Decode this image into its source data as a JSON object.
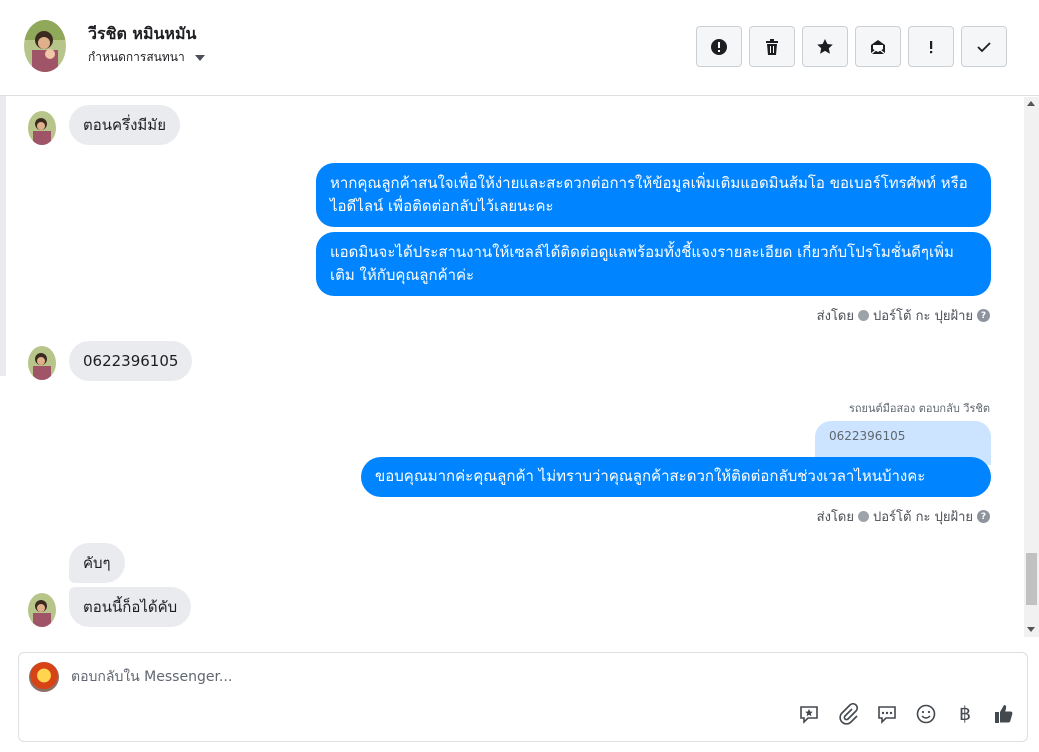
{
  "header": {
    "name": "วีรชิต หมินหมัน",
    "subtitle": "กำหนดการสนทนา"
  },
  "actions": [
    {
      "name": "spam-button",
      "icon": "exclamation-circle-icon"
    },
    {
      "name": "delete-button",
      "icon": "trash-icon"
    },
    {
      "name": "star-button",
      "icon": "star-icon"
    },
    {
      "name": "mark-unread-button",
      "icon": "envelope-open-icon"
    },
    {
      "name": "important-button",
      "icon": "exclamation-icon"
    },
    {
      "name": "done-button",
      "icon": "check-icon"
    }
  ],
  "messages": {
    "m1": "ตอนครึ่งมีมัย",
    "m2": "หากคุณลูกค้าสนใจเพื่อให้ง่ายและสะดวกต่อการให้ข้อมูลเพิ่มเติมแอดมินส้มโอ ขอเบอร์โทรศัพท์ หรือ ไอดีไลน์ เพื่อติดต่อกลับไว้เลยนะคะ",
    "m3": "แอดมินจะได้ประสานงานให้เซลล์ได้ติดต่อดูแลพร้อมทั้งชี้แจงรายละเอียด เกี่ยวกับโปรโมชั่นดีๆเพิ่มเติม ให้กับคุณลูกค้าค่ะ",
    "sent_by_1": "ส่งโดย",
    "sender_1": "ปอร์โต้ กะ ปุยฝ้าย",
    "m4": "0622396105",
    "reply_meta": "รถยนต์มือสอง ตอบกลับ วีรชิต",
    "quoted": "0622396105",
    "m5": "ขอบคุณมากค่ะคุณลูกค้า ไม่ทราบว่าคุณลูกค้าสะดวกให้ติดต่อกลับช่วงเวลาไหนบ้างคะ",
    "sent_by_2": "ส่งโดย",
    "sender_2": "ปอร์โต้ กะ ปุยฝ้าย",
    "m6": "คับๆ",
    "m7": "ตอนนี้ก็อได้คับ"
  },
  "composer": {
    "placeholder": "ตอบกลับใน Messenger...",
    "tools": [
      "saved-reply-icon",
      "attachment-icon",
      "chat-bubble-icon",
      "emoji-icon",
      "baht-icon",
      "like-icon"
    ],
    "baht_symbol": "฿"
  },
  "colors": {
    "outgoing": "#0084ff",
    "incoming": "#e9ebee",
    "quoted": "#cce4ff"
  }
}
